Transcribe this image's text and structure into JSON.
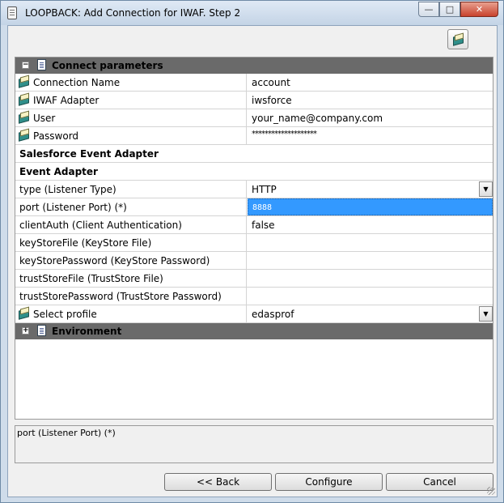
{
  "window": {
    "title": "LOOPBACK: Add Connection for IWAF. Step 2",
    "min_glyph": "—",
    "max_glyph": "□",
    "close_glyph": "✕"
  },
  "toolbar": {
    "icon": "book-icon"
  },
  "sections": {
    "connect": {
      "label": "Connect parameters",
      "toggle": "−"
    },
    "environment": {
      "label": "Environment",
      "toggle": "+"
    }
  },
  "connect_rows": [
    {
      "name": "Connection Name",
      "value": "account"
    },
    {
      "name": "IWAF Adapter",
      "value": "iwsforce"
    },
    {
      "name": "User",
      "value": "your_name@company.com"
    },
    {
      "name": "Password",
      "value": "********************"
    }
  ],
  "groups": {
    "salesforce": "Salesforce Event Adapter",
    "event": "Event Adapter"
  },
  "event_rows": [
    {
      "name": "type (Listener Type)",
      "value": "HTTP"
    },
    {
      "name": "port (Listener Port) (*)",
      "value": "8888"
    },
    {
      "name": "clientAuth (Client Authentication)",
      "value": "false"
    },
    {
      "name": "keyStoreFile (KeyStore File)",
      "value": ""
    },
    {
      "name": "keyStorePassword (KeyStore Password)",
      "value": ""
    },
    {
      "name": "trustStoreFile (TrustStore File)",
      "value": ""
    },
    {
      "name": "trustStorePassword (TrustStore Password)",
      "value": ""
    }
  ],
  "profile_row": {
    "name": "Select profile",
    "value": "edasprof"
  },
  "dropdown_glyph": "▼",
  "description": "port (Listener Port) (*)",
  "buttons": {
    "back": "<< Back",
    "configure": "Configure",
    "cancel": "Cancel"
  }
}
